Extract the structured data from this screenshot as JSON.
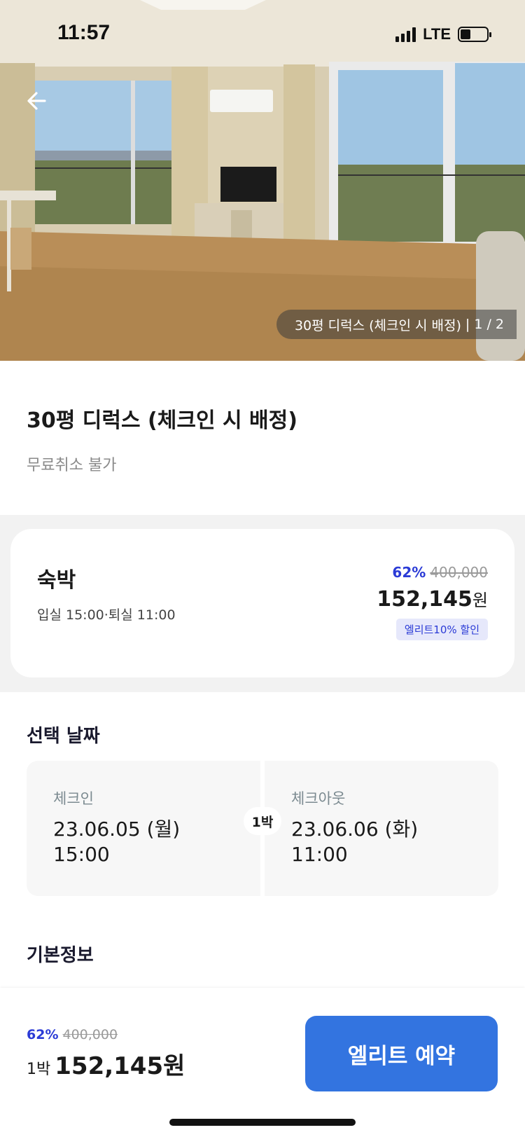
{
  "status_bar": {
    "time": "11:57",
    "network": "LTE"
  },
  "hero": {
    "caption": "30평 디럭스 (체크인 시 배정)",
    "separator": "|",
    "counter": "1 / 2"
  },
  "room": {
    "title": "30평 디럭스 (체크인 시 배정)",
    "cancel_policy": "무료취소 불가"
  },
  "stay": {
    "label": "숙박",
    "times": "입실 15:00·퇴실 11:00",
    "discount": "62%",
    "original_price": "400,000",
    "final_price": "152,145",
    "currency": "원",
    "badge": "엘리트10% 할인"
  },
  "dates": {
    "section_title": "선택 날짜",
    "checkin_label": "체크인",
    "checkin_date": "23.06.05 (월)",
    "checkin_time": "15:00",
    "nights": "1박",
    "checkout_label": "체크아웃",
    "checkout_date": "23.06.06 (화)",
    "checkout_time": "11:00"
  },
  "basic_info": {
    "title": "기본정보"
  },
  "bottom": {
    "discount": "62%",
    "original_price": "400,000",
    "nights": "1박",
    "final_price": "152,145원",
    "reserve_label": "엘리트 예약"
  },
  "colors": {
    "accent": "#3374e0",
    "discount": "#2b3bd6",
    "band": "#f2f2f2"
  }
}
